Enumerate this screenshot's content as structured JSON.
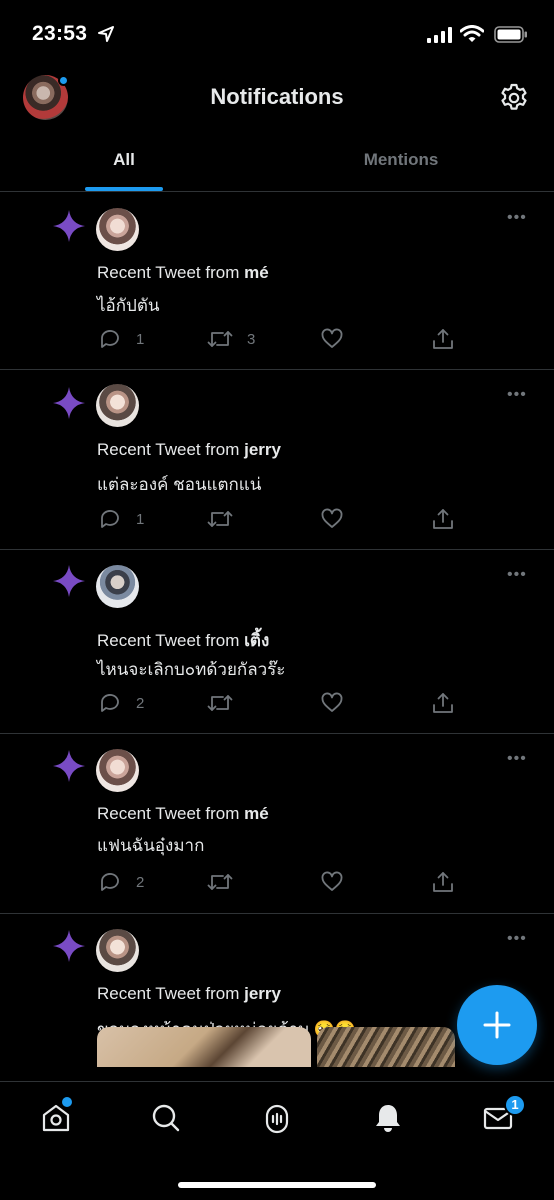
{
  "status_bar": {
    "time": "23:53",
    "icons": [
      "location-arrow-icon",
      "signal-icon",
      "wifi-icon",
      "battery-icon"
    ]
  },
  "header": {
    "title": "Notifications",
    "settings_icon": "gear-icon"
  },
  "tabs": [
    {
      "label": "All",
      "active": true
    },
    {
      "label": "Mentions",
      "active": false
    }
  ],
  "notifications": [
    {
      "prefix": "Recent Tweet from ",
      "author": "mé",
      "text": "ไอ้กัปตัน",
      "replies": "1",
      "retweets": "3"
    },
    {
      "prefix": "Recent Tweet from ",
      "author": "jerry",
      "text": "แต่ละองค์ ชอนแตกแน่",
      "replies": "1",
      "retweets": ""
    },
    {
      "prefix": "Recent Tweet from ",
      "author": "เติ้ง",
      "text": "ไหนจะเลิกบ๐ทด้วยกัลวร๊ะ",
      "replies": "2",
      "retweets": ""
    },
    {
      "prefix": "Recent Tweet from ",
      "author": "mé",
      "text": "แฟนฉันอุ๋งมาก",
      "replies": "2",
      "retweets": ""
    },
    {
      "prefix": "Recent Tweet from ",
      "author": "jerry",
      "text": "ขอมองหน้าคนป่วยหน่อยค้าบ 🥺🥺",
      "replies": "",
      "retweets": ""
    }
  ],
  "tabbar": {
    "messages_badge": "1",
    "icons": [
      "home-icon",
      "search-icon",
      "spaces-icon",
      "bell-icon",
      "mail-icon"
    ]
  },
  "colors": {
    "accent": "#1d9bf0",
    "spark": "#794bc4",
    "muted": "#71767b",
    "background": "#000000"
  }
}
